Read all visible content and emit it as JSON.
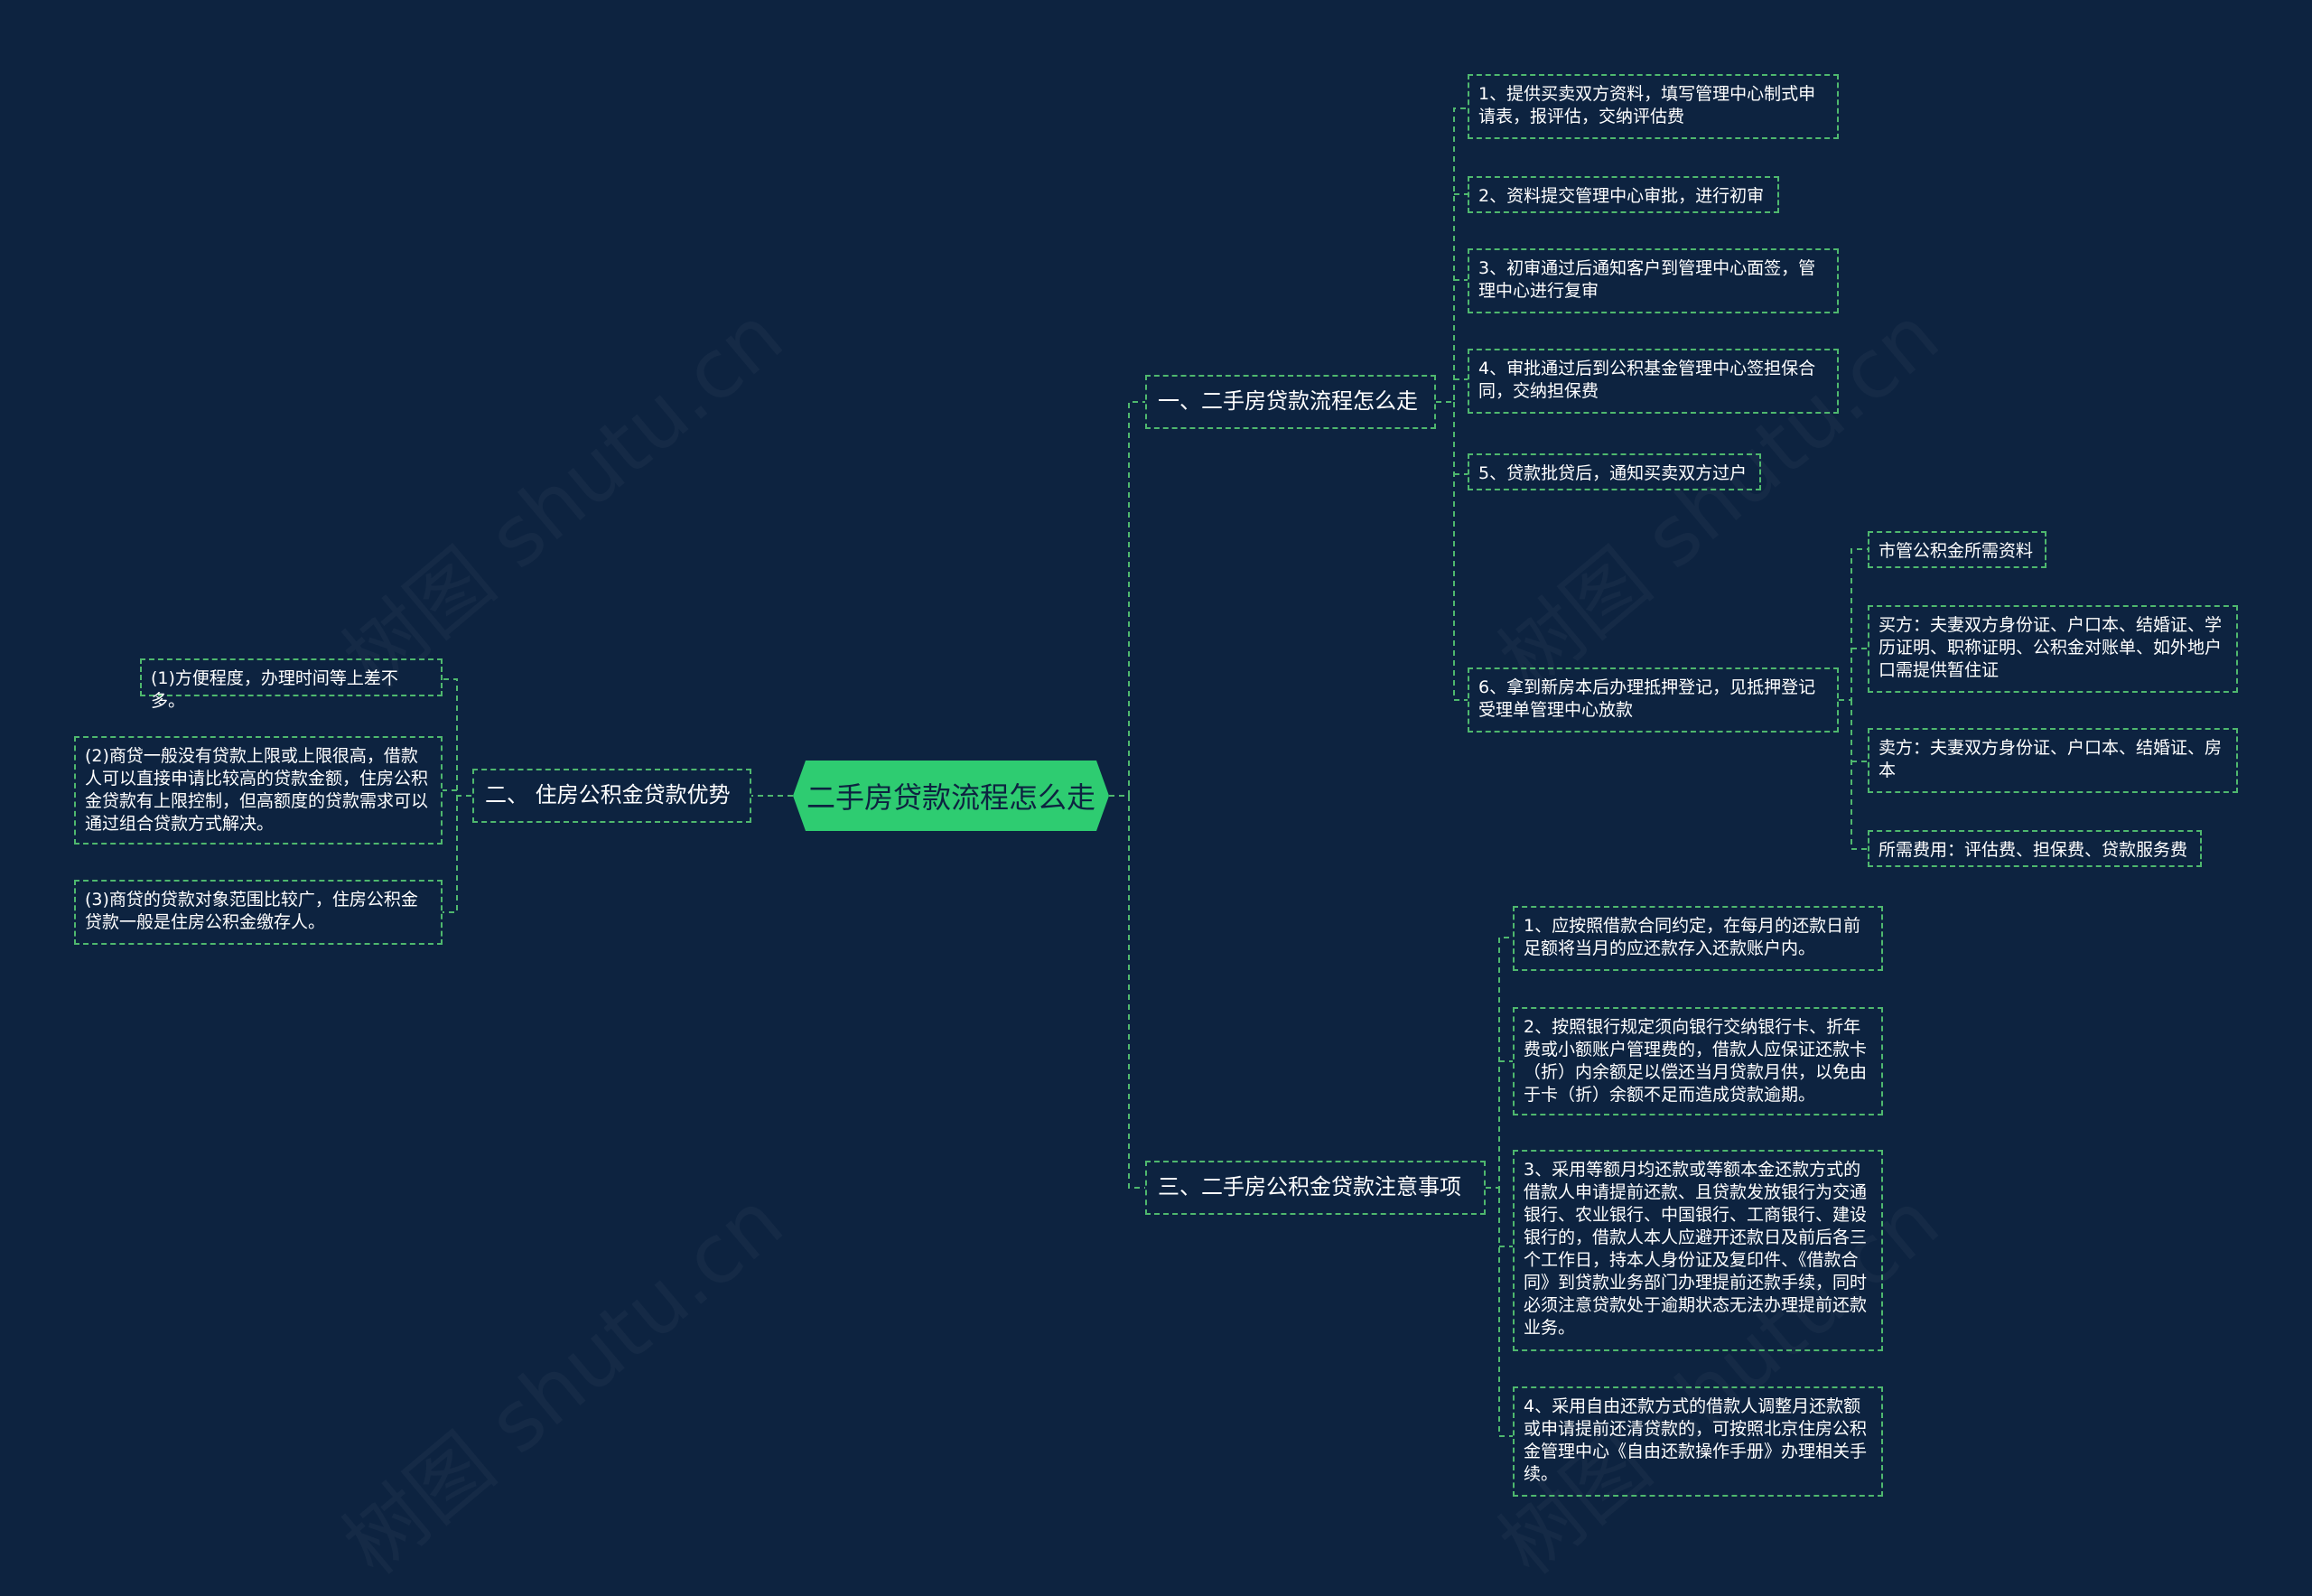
{
  "root": "二手房贷款流程怎么走",
  "branch1": {
    "label": "一、二手房贷款流程怎么走",
    "steps": [
      "1、提供买卖双方资料，填写管理中心制式申请表，报评估，交纳评估费",
      "2、资料提交管理中心审批，进行初审",
      "3、初审通过后通知客户到管理中心面签，管理中心进行复审",
      "4、审批通过后到公积基金管理中心签担保合同，交纳担保费",
      "5、贷款批贷后，通知买卖双方过户",
      "6、拿到新房本后办理抵押登记，见抵押登记受理单管理中心放款"
    ],
    "step6_children": [
      "市管公积金所需资料",
      "买方：夫妻双方身份证、户口本、结婚证、学历证明、职称证明、公积金对账单、如外地户口需提供暂住证",
      "卖方：夫妻双方身份证、户口本、结婚证、房本",
      "所需费用：评估费、担保费、贷款服务费"
    ]
  },
  "branch2": {
    "label": "二、 住房公积金贷款优势",
    "items": [
      "(1)方便程度，办理时间等上差不多。",
      "(2)商贷一般没有贷款上限或上限很高，借款人可以直接申请比较高的贷款金额，住房公积金贷款有上限控制，但高额度的贷款需求可以通过组合贷款方式解决。",
      "(3)商贷的贷款对象范围比较广，住房公积金贷款一般是住房公积金缴存人。"
    ]
  },
  "branch3": {
    "label": "三、二手房公积金贷款注意事项",
    "items": [
      "1、应按照借款合同约定，在每月的还款日前足额将当月的应还款存入还款账户内。",
      "2、按照银行规定须向银行交纳银行卡、折年费或小额账户管理费的，借款人应保证还款卡（折）内余额足以偿还当月贷款月供，以免由于卡（折）余额不足而造成贷款逾期。",
      "3、采用等额月均还款或等额本金还款方式的借款人申请提前还款、且贷款发放银行为交通银行、农业银行、中国银行、工商银行、建设银行的，借款人本人应避开还款日及前后各三个工作日，持本人身份证及复印件、《借款合同》到贷款业务部门办理提前还款手续，同时必须注意贷款处于逾期状态无法办理提前还款业务。",
      "4、采用自由还款方式的借款人调整月还款额或申请提前还清贷款的，可按照北京住房公积金管理中心《自由还款操作手册》办理相关手续。"
    ]
  },
  "watermark": "树图 shutu.cn",
  "colors": {
    "background": "#0d2340",
    "accent": "#2ecc71",
    "line": "#4fb86e"
  }
}
